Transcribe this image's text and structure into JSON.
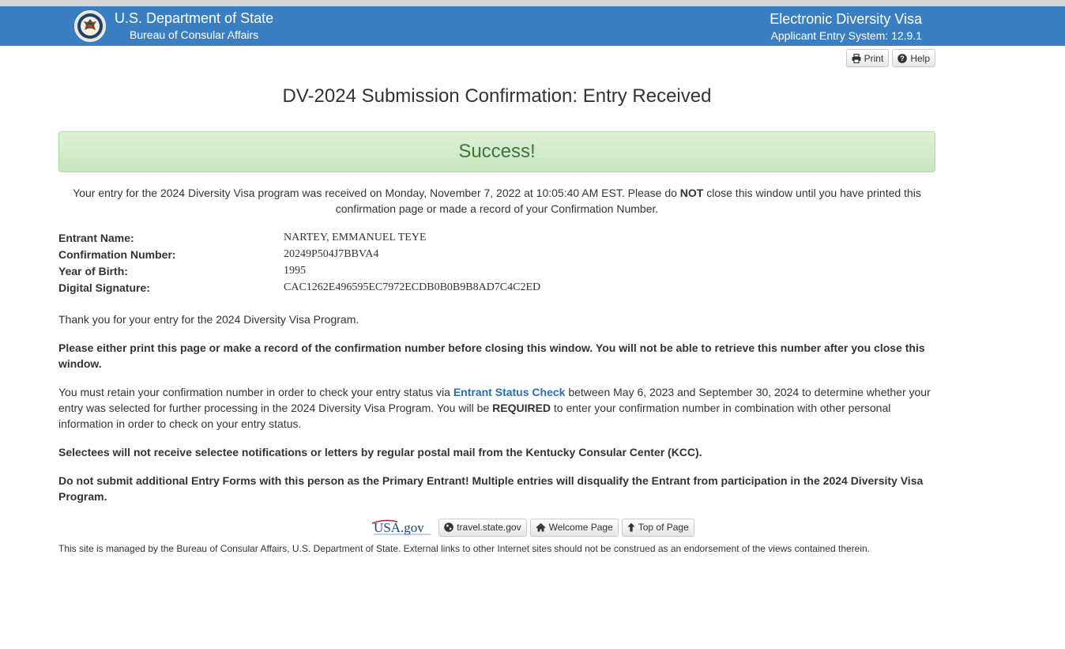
{
  "header": {
    "dept_title": "U.S. Department of State",
    "dept_sub": "Bureau of Consular Affairs",
    "system_title": "Electronic Diversity Visa",
    "system_sub": "Applicant Entry System: 12.9.1",
    "bg_color": "#3a7fc1"
  },
  "toolbar": {
    "print_label": "Print",
    "print_icon": "print-icon",
    "help_label": "Help",
    "help_icon": "question-circle-icon"
  },
  "page": {
    "title": "DV-2024 Submission Confirmation: Entry Received"
  },
  "alert": {
    "text": "Success!",
    "color": "#3c763d"
  },
  "intro": {
    "part1": "Your entry for the 2024 Diversity Visa program was received on Monday, November 7, 2022 at 10:05:40 AM EST. Please do ",
    "emphasis": "NOT",
    "part2": " close this window until you have printed this confirmation page or made a record of your Confirmation Number."
  },
  "details": [
    {
      "label": "Entrant Name:",
      "value": "NARTEY, EMMANUEL TEYE"
    },
    {
      "label": "Confirmation Number:",
      "value": "20249P504J7BBVA4"
    },
    {
      "label": "Year of Birth:",
      "value": "1995"
    },
    {
      "label": "Digital Signature:",
      "value": "CAC1262E496595EC7972ECDB0B0B9B8AD7C4C2ED"
    }
  ],
  "messages": {
    "thank_you": "Thank you for your entry for the 2024 Diversity Visa Program.",
    "print_warning": "Please either print this page or make a record of the confirmation number before closing this window. You will not be able to retrieve this number after you close this window.",
    "retain_part1": "You must retain your confirmation number in order to check your entry status via ",
    "retain_link": "Entrant Status Check",
    "retain_part2": " between May 6, 2023 and September 30, 2024 to determine whether your entry was selected for further processing in the 2024 Diversity Visa Program. You will be ",
    "retain_emphasis": "REQUIRED",
    "retain_part3": " to enter your confirmation number in combination with other personal information in order to check on your entry status.",
    "no_mail": "Selectees will not receive selectee notifications or letters by regular postal mail from the Kentucky Consular Center (KCC).",
    "no_multiple": "Do not submit additional Entry Forms with this person as the Primary Entrant! Multiple entries will disqualify the Entrant from participation in the 2024 Diversity Visa Program."
  },
  "footer": {
    "usa_logo_text": "USA.gov",
    "travel_label": "travel.state.gov",
    "travel_icon": "globe-icon",
    "welcome_label": "Welcome Page",
    "welcome_icon": "home-icon",
    "top_label": "Top of Page",
    "top_icon": "arrow-up-icon",
    "disclaimer": "This site is managed by the Bureau of Consular Affairs, U.S. Department of State. External links to other Internet sites should not be construed as an endorsement of the views contained therein."
  }
}
